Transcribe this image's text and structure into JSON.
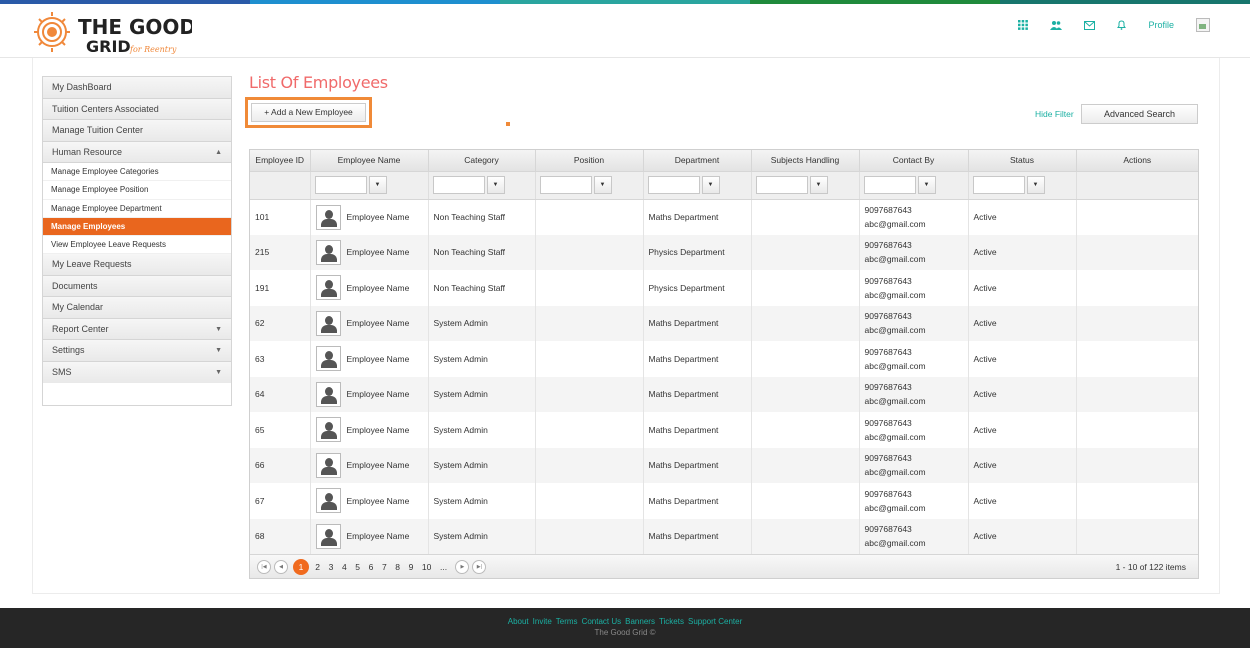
{
  "brand": {
    "logo_text_top": "THE GOOD",
    "logo_text_bottom": "GRID",
    "logo_tagline": "for Reentry",
    "strip_colors": [
      "#2a5aa8",
      "#1e8fcf",
      "#2aa59f",
      "#1f8a3c",
      "#17766d"
    ]
  },
  "header": {
    "icons": [
      "grid-icon",
      "users-icon",
      "mail-icon",
      "bell-icon"
    ],
    "profile_label": "Profile"
  },
  "sidebar": {
    "items": [
      {
        "label": "My DashBoard"
      },
      {
        "label": "Tuition Centers Associated"
      },
      {
        "label": "Manage Tuition Center"
      },
      {
        "label": "Human Resource",
        "caret": "▲"
      }
    ],
    "sub_items": [
      {
        "label": "Manage Employee Categories"
      },
      {
        "label": "Manage Employee Position"
      },
      {
        "label": "Manage Employee Department"
      },
      {
        "label": "Manage Employees",
        "active": true
      },
      {
        "label": "View Employee Leave Requests"
      }
    ],
    "items_after": [
      {
        "label": "My Leave Requests"
      },
      {
        "label": "Documents"
      },
      {
        "label": "My Calendar"
      },
      {
        "label": "Report Center",
        "caret": "▼"
      },
      {
        "label": "Settings",
        "caret": "▼"
      },
      {
        "label": "SMS",
        "caret": "▼"
      }
    ]
  },
  "main": {
    "title": "List Of Employees",
    "add_button": "+ Add a New Employee",
    "hide_filter": "Hide Filter",
    "advanced_search": "Advanced Search"
  },
  "table": {
    "columns": [
      "Employee ID",
      "Employee Name",
      "Category",
      "Position",
      "Department",
      "Subjects Handling",
      "Contact By",
      "Status",
      "Actions"
    ],
    "rows": [
      {
        "id": "101",
        "name": "Employee Name",
        "category": "Non Teaching Staff",
        "position": "",
        "department": "Maths Department",
        "subjects": "",
        "phone": "9097687643",
        "email": "abc@gmail.com",
        "status": "Active"
      },
      {
        "id": "215",
        "name": "Employee Name",
        "category": "Non Teaching Staff",
        "position": "",
        "department": "Physics Department",
        "subjects": "",
        "phone": "9097687643",
        "email": "abc@gmail.com",
        "status": "Active"
      },
      {
        "id": "191",
        "name": "Employee Name",
        "category": "Non Teaching Staff",
        "position": "",
        "department": "Physics Department",
        "subjects": "",
        "phone": "9097687643",
        "email": "abc@gmail.com",
        "status": "Active"
      },
      {
        "id": "62",
        "name": "Employee Name",
        "category": "System Admin",
        "position": "",
        "department": "Maths Department",
        "subjects": "",
        "phone": "9097687643",
        "email": "abc@gmail.com",
        "status": "Active"
      },
      {
        "id": "63",
        "name": "Employee Name",
        "category": "System Admin",
        "position": "",
        "department": "Maths Department",
        "subjects": "",
        "phone": "9097687643",
        "email": "abc@gmail.com",
        "status": "Active"
      },
      {
        "id": "64",
        "name": "Employee Name",
        "category": "System Admin",
        "position": "",
        "department": "Maths Department",
        "subjects": "",
        "phone": "9097687643",
        "email": "abc@gmail.com",
        "status": "Active"
      },
      {
        "id": "65",
        "name": "Employee Name",
        "category": "System Admin",
        "position": "",
        "department": "Maths Department",
        "subjects": "",
        "phone": "9097687643",
        "email": "abc@gmail.com",
        "status": "Active"
      },
      {
        "id": "66",
        "name": "Employee Name",
        "category": "System Admin",
        "position": "",
        "department": "Maths Department",
        "subjects": "",
        "phone": "9097687643",
        "email": "abc@gmail.com",
        "status": "Active"
      },
      {
        "id": "67",
        "name": "Employee Name",
        "category": "System Admin",
        "position": "",
        "department": "Maths Department",
        "subjects": "",
        "phone": "9097687643",
        "email": "abc@gmail.com",
        "status": "Active"
      },
      {
        "id": "68",
        "name": "Employee Name",
        "category": "System Admin",
        "position": "",
        "department": "Maths Department",
        "subjects": "",
        "phone": "9097687643",
        "email": "abc@gmail.com",
        "status": "Active"
      }
    ]
  },
  "pager": {
    "pages": [
      "1",
      "2",
      "3",
      "4",
      "5",
      "6",
      "7",
      "8",
      "9",
      "10",
      "..."
    ],
    "current": "1",
    "info": "1 - 10 of 122 items"
  },
  "footer": {
    "links": [
      "About",
      "Invite",
      "Terms",
      "Contact Us",
      "Banners",
      "Tickets",
      "Support Center"
    ],
    "copyright": "The Good Grid ©"
  }
}
